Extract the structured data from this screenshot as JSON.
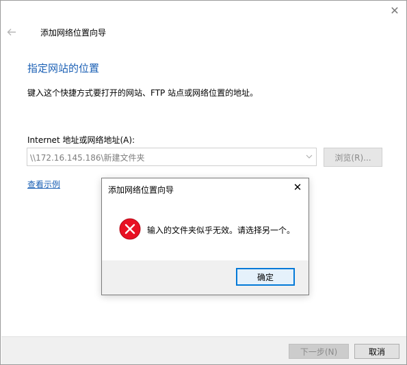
{
  "window": {
    "close_glyph": "✕"
  },
  "wizard": {
    "title": "添加网络位置向导",
    "heading": "指定网站的位置",
    "instruction": "键入这个快捷方式要打开的网站、FTP 站点或网络位置的地址。",
    "field_label": "Internet 地址或网络地址(A):",
    "address_value": "\\\\172.16.145.186\\新建文件夹",
    "browse_label": "浏览(R)...",
    "example_link": "查看示例",
    "next_label": "下一步(N)",
    "cancel_label": "取消",
    "accent_color": "#1a5fb4"
  },
  "dialog": {
    "title": "添加网络位置向导",
    "close_glyph": "✕",
    "message": "输入的文件夹似乎无效。请选择另一个。",
    "ok_label": "确定",
    "icon": "error-icon",
    "icon_color": "#e81123"
  }
}
